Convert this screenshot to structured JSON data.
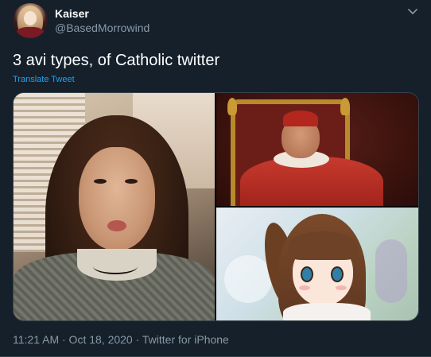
{
  "tweet": {
    "display_name": "Kaiser",
    "handle": "@BasedMorrowind",
    "text": "3 avi types, of Catholic twitter",
    "translate_label": "Translate Tweet",
    "timestamp_and_source": "11:21 AM · Oct 18, 2020 · Twitter for iPhone"
  },
  "icons": {
    "caret": "chevron-down-icon"
  },
  "colors": {
    "background": "#15202b",
    "secondary_text": "#8899a6",
    "link": "#1da1f2",
    "border": "#38444d"
  }
}
